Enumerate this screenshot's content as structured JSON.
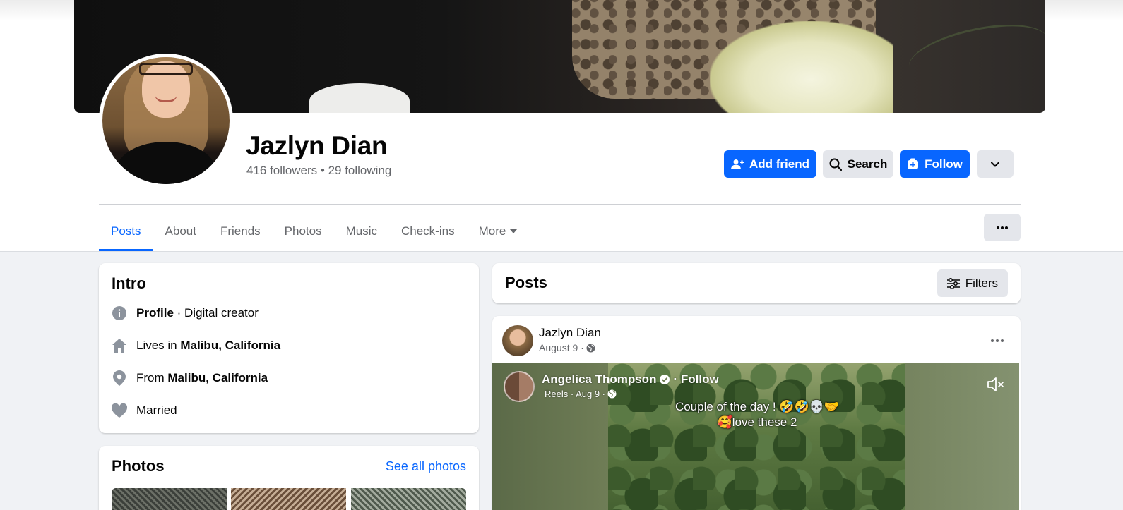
{
  "profile": {
    "name": "Jazlyn Dian",
    "stats": "416 followers • 29 following"
  },
  "actions": {
    "add_friend": "Add friend",
    "search": "Search",
    "follow": "Follow"
  },
  "tabs": [
    {
      "label": "Posts",
      "active": true
    },
    {
      "label": "About"
    },
    {
      "label": "Friends"
    },
    {
      "label": "Photos"
    },
    {
      "label": "Music"
    },
    {
      "label": "Check-ins"
    },
    {
      "label": "More"
    }
  ],
  "intro": {
    "title": "Intro",
    "rows": [
      {
        "icon": "info-icon",
        "bold_prefix": "Profile",
        "text": " · Digital creator"
      },
      {
        "icon": "home-icon",
        "text": "Lives in ",
        "bold": "Malibu, California"
      },
      {
        "icon": "location-pin-icon",
        "text": "From ",
        "bold": "Malibu, California"
      },
      {
        "icon": "heart-icon",
        "text": "Married"
      }
    ]
  },
  "photos": {
    "title": "Photos",
    "see_all": "See all photos"
  },
  "posts": {
    "title": "Posts",
    "filters": "Filters",
    "post": {
      "author": "Jazlyn Dian",
      "date": "August 9 ·",
      "reel": {
        "author": "Angelica Thompson",
        "follow": "· Follow",
        "meta": "Reels · Aug 9 ·",
        "caption_line1": "Couple of the day ! 🤣🤣💀🤝",
        "caption_line2": "🥰love these 2"
      }
    }
  },
  "colors": {
    "accent": "#0866ff",
    "secondary_button": "#e4e6eb",
    "page_background": "#f0f2f5",
    "muted_text": "#65676b"
  }
}
